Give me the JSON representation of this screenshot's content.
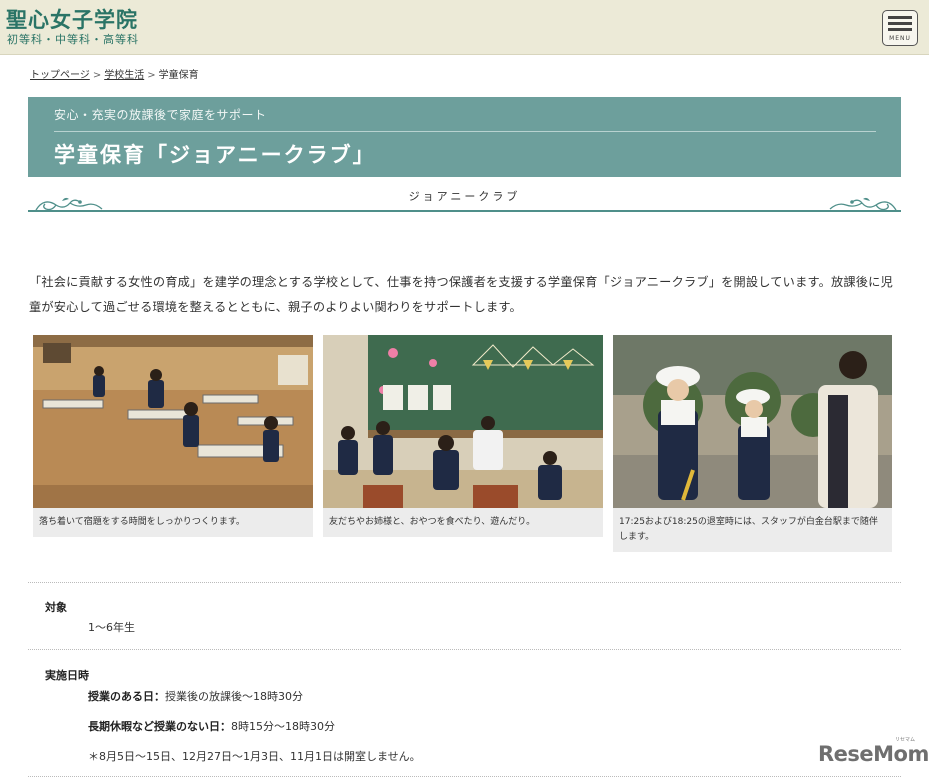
{
  "header": {
    "logo_main": "聖心女子学院",
    "logo_sub": "初等科・中等科・高等科",
    "menu_label": "MENU"
  },
  "breadcrumb": {
    "items": [
      "トップページ",
      "学校生活",
      "学童保育"
    ],
    "separator": ">"
  },
  "banner": {
    "subtitle": "安心・充実の放課後で家庭をサポート",
    "title": "学童保育「ジョアニークラブ」",
    "bg_color": "#6d9f9c"
  },
  "section_heading": "ジョアニークラブ",
  "intro": "「社会に貢献する女性の育成」を建学の理念とする学校として、仕事を持つ保護者を支援する学童保育「ジョアニークラブ」を開設しています。放課後に児童が安心して過ごせる環境を整えるとともに、親子のよりよい関わりをサポートします。",
  "photos": [
    {
      "caption": "落ち着いて宿題をする時間をしっかりつくります。"
    },
    {
      "caption": "友だちやお姉様と、おやつを食べたり、遊んだり。"
    },
    {
      "caption": "17:25および18:25の退室時には、スタッフが白金台駅まで随伴します。"
    }
  ],
  "info": {
    "target_label": "対象",
    "target_value": "1〜6年生",
    "schedule_label": "実施日時",
    "schedule_line1_label": "授業のある日：",
    "schedule_line1_value": "授業後の放課後〜18時30分",
    "schedule_line2_label": "長期休暇など授業のない日：",
    "schedule_line2_value": "8時15分〜18時30分",
    "schedule_note": "＊8月5日〜15日、12月27日〜1月3日、11月1日は開室しません。"
  },
  "watermark": {
    "text": "ReseMom",
    "small": "リセマム"
  },
  "colors": {
    "accent": "#2a7466",
    "header_bg": "#ecead7",
    "rule": "#4f8f8a"
  }
}
